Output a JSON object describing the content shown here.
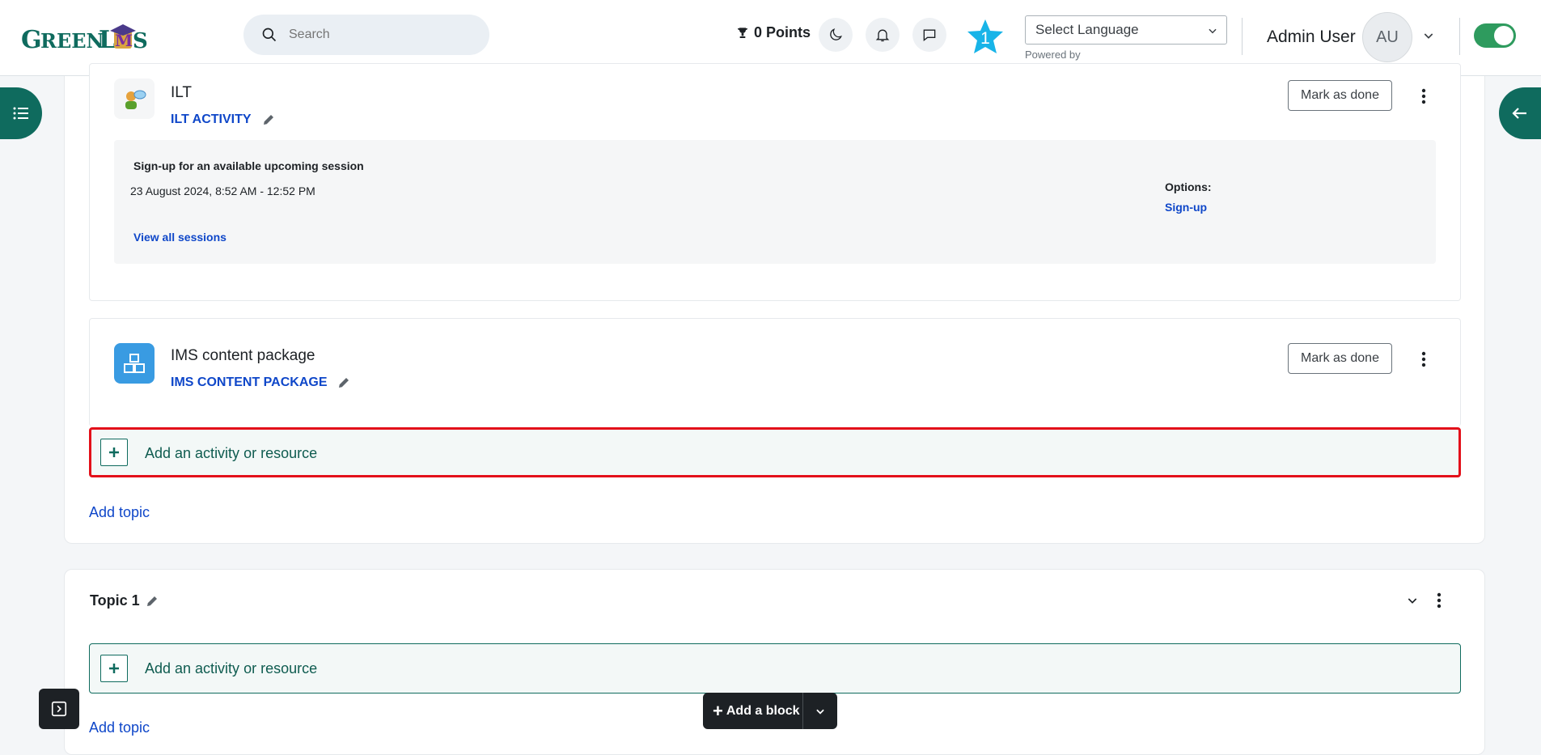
{
  "header": {
    "logo": "GREEN LMS",
    "search_placeholder": "Search",
    "points": "0 Points",
    "notification_badge": "1",
    "language_select": "Select Language",
    "powered_by": "Powered by",
    "user_name": "Admin User",
    "avatar_initials": "AU"
  },
  "activities": [
    {
      "type": "ILT",
      "link": "ILT ACTIVITY",
      "mark_label": "Mark as done",
      "session": {
        "title": "Sign-up for an available upcoming session",
        "date": "23 August 2024, 8:52 AM - 12:52 PM",
        "view_all": "View all sessions",
        "options_label": "Options:",
        "signup": "Sign-up"
      }
    },
    {
      "type": "IMS content package",
      "link": "IMS CONTENT PACKAGE",
      "mark_label": "Mark as done"
    }
  ],
  "section": {
    "add_activity": "Add an activity or resource",
    "add_topic": "Add topic"
  },
  "topic1": {
    "title": "Topic 1",
    "add_activity": "Add an activity or resource",
    "add_topic": "Add topic"
  },
  "footer": {
    "add_block": "Add a block"
  },
  "colors": {
    "brand": "#0f6b5e",
    "link": "#0f47c9",
    "highlight": "#e3101a"
  }
}
